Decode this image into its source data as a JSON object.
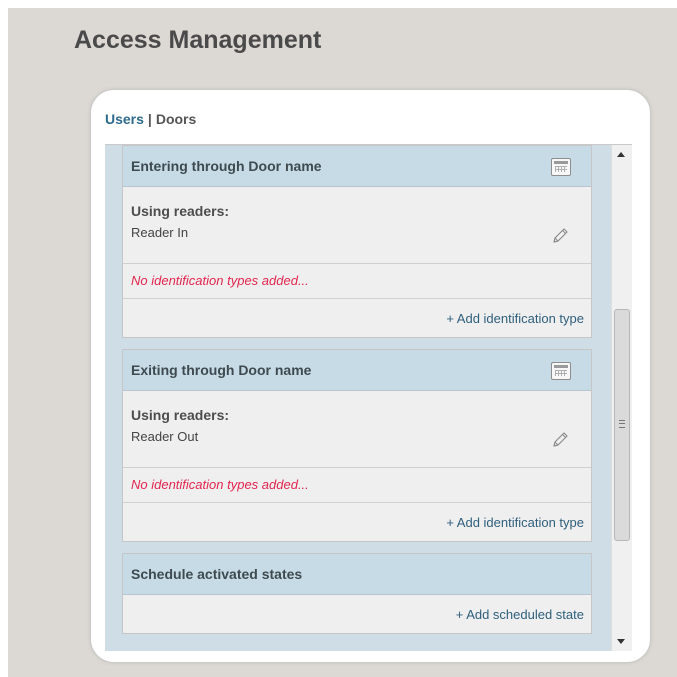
{
  "page": {
    "title": "Access Management"
  },
  "tabs": {
    "users": "Users",
    "separator": "|",
    "doors": "Doors"
  },
  "sections": [
    {
      "title": "Entering through Door name",
      "readers_label": "Using readers:",
      "readers_value": "Reader In",
      "no_id_text": "No identification types added...",
      "add_link": "+ Add identification type"
    },
    {
      "title": "Exiting through Door name",
      "readers_label": "Using readers:",
      "readers_value": "Reader Out",
      "no_id_text": "No identification types added...",
      "add_link": "+ Add identification type"
    },
    {
      "title": "Schedule activated states",
      "add_link": "+ Add scheduled state"
    }
  ],
  "colors": {
    "accent": "#2e6b8d",
    "warning_text": "#e2264f",
    "section_header": "#c6dbe5"
  },
  "icons": [
    "calendar-icon",
    "pencil-icon",
    "scroll-up-arrow-icon",
    "scroll-down-arrow-icon",
    "scrollbar-grip-icon"
  ]
}
